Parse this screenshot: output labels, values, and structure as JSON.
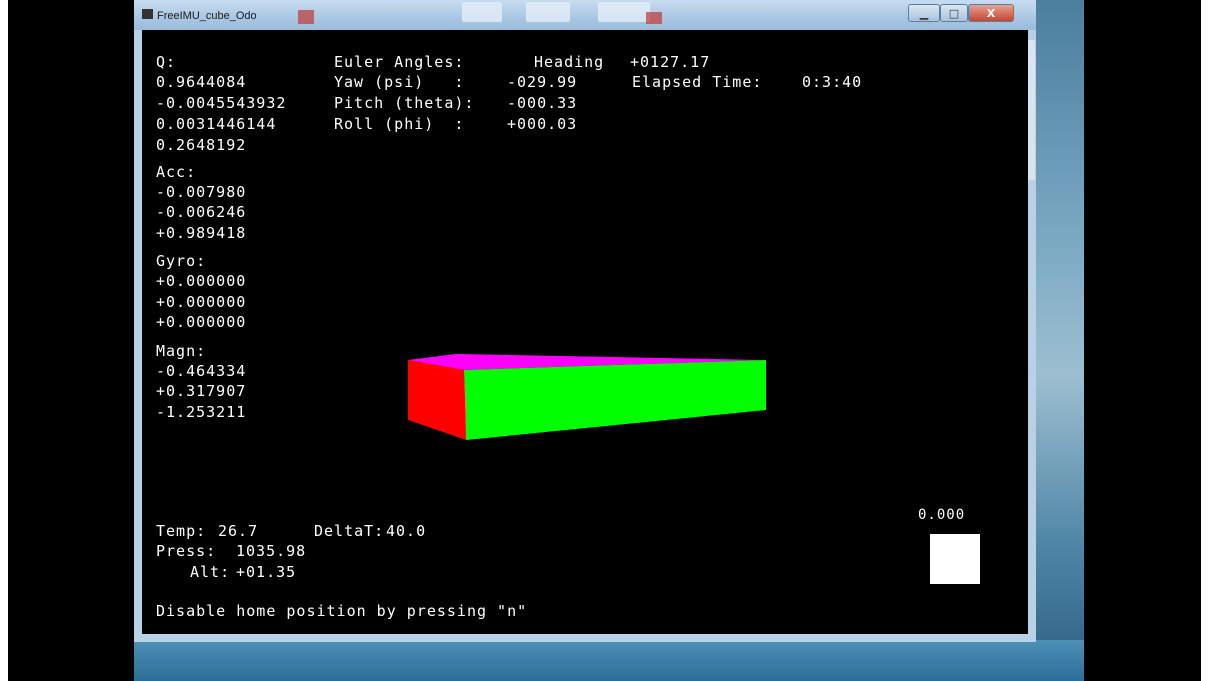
{
  "window": {
    "title": "FreeIMU_cube_Odo",
    "min_glyph": "▁",
    "max_glyph": "□",
    "close_glyph": "X"
  },
  "quaternion": {
    "label": "Q:",
    "values": [
      "0.9644084",
      "-0.0045543932",
      "0.0031446144",
      "0.2648192"
    ]
  },
  "euler": {
    "label": "Euler Angles:",
    "heading_label": "Heading",
    "heading_value": "+0127.17",
    "yaw_label": "Yaw (psi)   :",
    "yaw_value": "-029.99",
    "pitch_label": "Pitch (theta):",
    "pitch_value": "-000.33",
    "roll_label": "Roll (phi)  :",
    "roll_value": "+000.03"
  },
  "elapsed": {
    "label": "Elapsed Time:",
    "value": "0:3:40"
  },
  "acc": {
    "label": "Acc:",
    "values": [
      "-0.007980",
      "-0.006246",
      "+0.989418"
    ]
  },
  "gyro": {
    "label": "Gyro:",
    "values": [
      "+0.000000",
      "+0.000000",
      "+0.000000"
    ]
  },
  "magn": {
    "label": "Magn:",
    "values": [
      "-0.464334",
      "+0.317907",
      "-1.253211"
    ]
  },
  "env": {
    "temp_label": "Temp:",
    "temp_value": "26.7",
    "deltat_label": "DeltaT:",
    "deltat_value": "40.0",
    "press_label": "Press:",
    "press_value": "1035.98",
    "alt_label": "Alt:",
    "alt_value": "+01.35"
  },
  "indicator": {
    "value": "0.000"
  },
  "footer": {
    "message": "Disable home position by pressing \"n\""
  },
  "colors": {
    "cube_top": "#ff00ff",
    "cube_side": "#ff0000",
    "cube_front": "#00ff00",
    "text": "#ffffff",
    "background": "#000000"
  }
}
